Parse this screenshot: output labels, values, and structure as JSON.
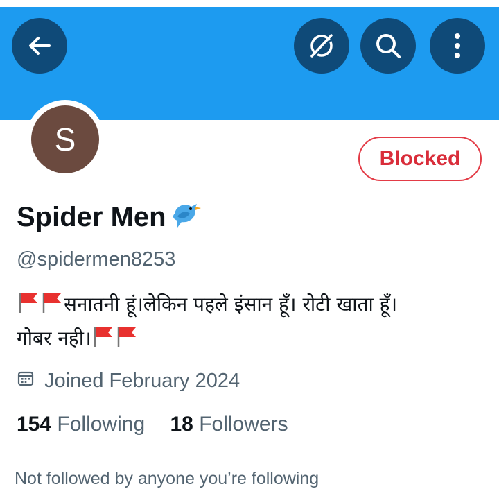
{
  "header": {
    "back_icon": "arrow-left-icon",
    "grok_icon": "grok-icon",
    "search_icon": "search-icon",
    "more_icon": "more-vertical-icon",
    "banner_color": "#1d9bf0",
    "button_color": "#0f4a78"
  },
  "profile": {
    "avatar_letter": "S",
    "avatar_color": "#6b4a3f",
    "display_name": "Spider Men",
    "name_emoji": "bird-icon",
    "handle": "@spidermen8253",
    "bio_line1": "सनातनी हूं।लेकिन पहले इंसान हूँ। रोटी खाता हूँ।",
    "bio_line2": "गोबर नही।",
    "bio_emoji": "red-flag-icon",
    "joined": "Joined February 2024",
    "following_count": "154",
    "following_label": "Following",
    "followers_count": "18",
    "followers_label": "Followers",
    "mutuals_note": "Not followed by anyone you’re following"
  },
  "actions": {
    "blocked_label": "Blocked",
    "blocked_color": "#d92d3a"
  }
}
